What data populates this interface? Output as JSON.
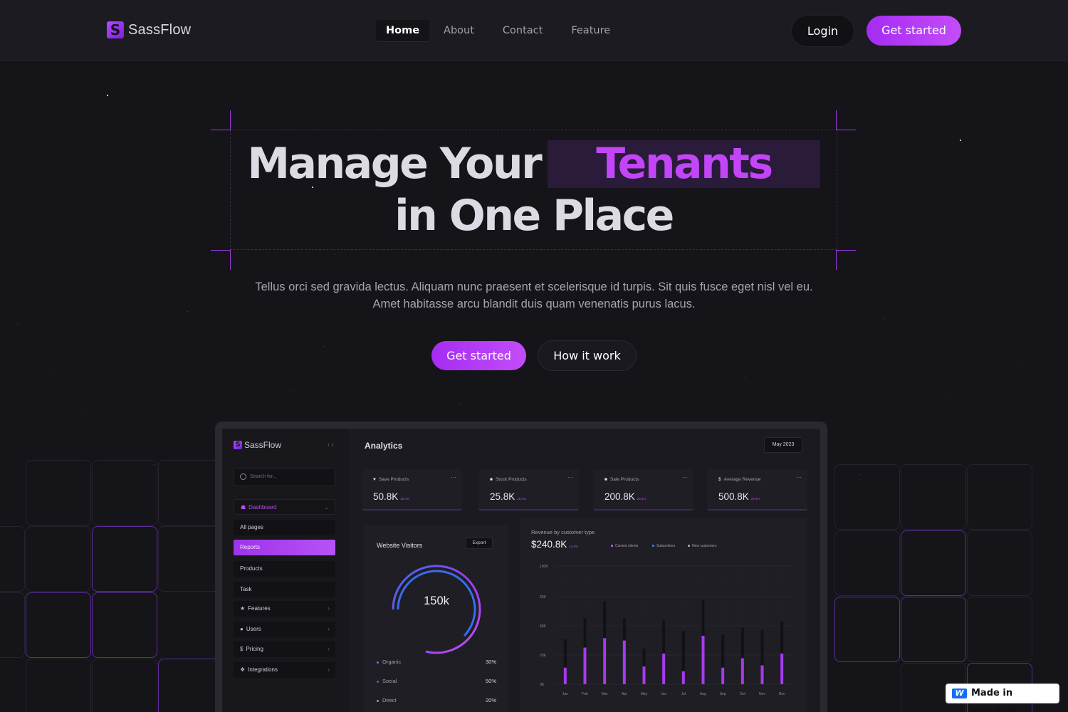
{
  "brand": {
    "name": "SassFlow",
    "mark": "S"
  },
  "nav": {
    "links": [
      {
        "label": "Home"
      },
      {
        "label": "About"
      },
      {
        "label": "Contact"
      },
      {
        "label": "Feature"
      }
    ],
    "login_label": "Login",
    "get_started_label": "Get started"
  },
  "hero": {
    "title_part1": "Manage Your",
    "title_highlight": "Tenants",
    "title_line2": "in One Place",
    "subtitle_line1": "Tellus orci sed gravida lectus. Aliquam nunc praesent et scelerisque id turpis. Sit quis fusce eget nisl vel eu.",
    "subtitle_line2": "Amet habitasse arcu blandit duis quam venenatis purus lacus.",
    "cta_primary": "Get started",
    "cta_secondary": "How it work"
  },
  "dashboard": {
    "brand": "SassFlow",
    "collapse_arrows": "‹ ›",
    "search_placeholder": "Search for...",
    "sidebar": [
      {
        "label": "Dashboard",
        "icon": "home-icon"
      },
      {
        "label": "All pages"
      },
      {
        "label": "Reports"
      },
      {
        "label": "Products"
      },
      {
        "label": "Task"
      },
      {
        "label": "Features",
        "icon": "star-icon"
      },
      {
        "label": "Users",
        "icon": "user-icon"
      },
      {
        "label": "Pricing",
        "icon": "dollar-icon"
      },
      {
        "label": "Integrations",
        "icon": "puzzle-icon"
      }
    ],
    "title": "Analytics",
    "date": "May 2023",
    "stats": [
      {
        "label": "Save Products",
        "value": "50.8K",
        "change": "28.4%",
        "icon": "heart-icon"
      },
      {
        "label": "Stock Products",
        "value": "25.8K",
        "change": "28.4%",
        "icon": "bag-icon"
      },
      {
        "label": "Sale Products",
        "value": "200.8K",
        "change": "28.4%",
        "icon": "cart-icon"
      },
      {
        "label": "Average Revenue",
        "value": "500.8K",
        "change": "28.4%",
        "icon": "coin-icon"
      }
    ],
    "visitors": {
      "title": "Website Visitors",
      "export_label": "Export",
      "total": "150k",
      "rows": [
        {
          "label": "Organic",
          "value": "30%",
          "color": "#b34ef0"
        },
        {
          "label": "Social",
          "value": "50%",
          "color": "#3b6cf0"
        },
        {
          "label": "Direct",
          "value": "20%",
          "color": "#9a98a2"
        }
      ]
    },
    "revenue": {
      "title": "Revenue by customer type",
      "total": "$240.8K",
      "change": "14.8%",
      "legend": [
        {
          "label": "Current clients",
          "color": "#b34ef0"
        },
        {
          "label": "Subscribers",
          "color": "#3b6cf0"
        },
        {
          "label": "New customers",
          "color": "#9a98a2"
        }
      ]
    }
  },
  "chart_data": {
    "type": "bar",
    "title": "Revenue by customer type",
    "categories": [
      "Jan",
      "Feb",
      "Mar",
      "Apr",
      "May",
      "Jun",
      "Jul",
      "Aug",
      "Sep",
      "Oct",
      "Nov",
      "Dec"
    ],
    "y_ticks": [
      "0K",
      "20K",
      "40K",
      "60K",
      "100K"
    ],
    "ylim": [
      0,
      100
    ],
    "series": [
      {
        "values": [
          14,
          31,
          39,
          37,
          15,
          26,
          11,
          41,
          14,
          22,
          16,
          26
        ],
        "color": "#a63af0"
      },
      {
        "values": [
          38,
          56,
          70,
          56,
          30,
          54,
          45,
          71,
          42,
          48,
          46,
          53
        ],
        "color": "#121116"
      }
    ]
  },
  "badge": {
    "label": "Made in Webflow",
    "mark": "W"
  }
}
